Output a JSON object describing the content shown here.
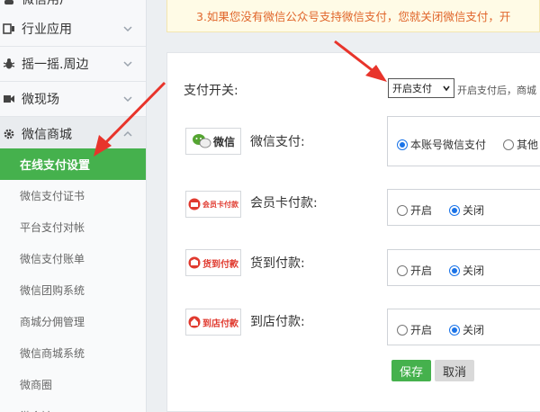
{
  "sidebar": {
    "items": [
      {
        "label": "微信用户",
        "icon": "user-icon"
      },
      {
        "label": "行业应用",
        "icon": "app-icon"
      },
      {
        "label": "摇一摇.周边",
        "icon": "bug-icon"
      },
      {
        "label": "微现场",
        "icon": "video-icon"
      },
      {
        "label": "微信商城",
        "icon": "gear-icon"
      }
    ],
    "subitems": [
      {
        "label": "在线支付设置"
      },
      {
        "label": "微信支付证书"
      },
      {
        "label": "平台支付对帐"
      },
      {
        "label": "微信支付账单"
      },
      {
        "label": "微信团购系统"
      },
      {
        "label": "商城分佣管理"
      },
      {
        "label": "微信商城系统"
      },
      {
        "label": "微商圈"
      },
      {
        "label": "微会馆"
      }
    ]
  },
  "notice": "3.如果您没有微信公众号支持微信支付，您就关闭微信支付，开",
  "pay_switch": {
    "label": "支付开关:",
    "selected": "开启支付",
    "hint": "开启支付后，商城"
  },
  "methods": [
    {
      "logo_text": "微信",
      "label": "微信支付:",
      "opt1": "本账号微信支付",
      "opt2": "其他"
    },
    {
      "logo_text": "会员卡付款",
      "label": "会员卡付款:",
      "opt1": "开启",
      "opt2": "关闭"
    },
    {
      "logo_text": "货到付款",
      "label": "货到付款:",
      "opt1": "开启",
      "opt2": "关闭"
    },
    {
      "logo_text": "到店付款",
      "label": "到店付款:",
      "opt1": "开启",
      "opt2": "关闭"
    }
  ],
  "buttons": {
    "save": "保存",
    "cancel": "取消"
  },
  "colors": {
    "accent_green": "#45b14d",
    "arrow_red": "#e8342b",
    "notice_orange": "#e0662b"
  }
}
